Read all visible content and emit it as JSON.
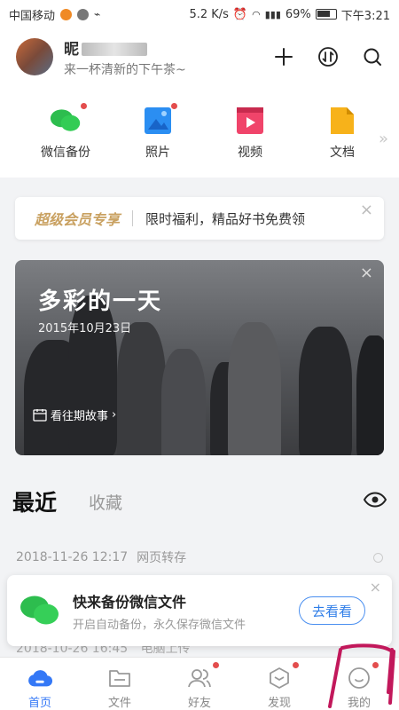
{
  "status_bar": {
    "carrier": "中国移动",
    "speed": "5.2 K/s",
    "battery": "69%",
    "time": "下午3:21"
  },
  "header": {
    "username_visible": "昵",
    "tagline": "来一杯清新的下午茶~",
    "icons": [
      "add-icon",
      "transfer-icon",
      "search-icon"
    ]
  },
  "quick_access": [
    {
      "label": "微信备份",
      "icon": "wechat-icon",
      "badge": true
    },
    {
      "label": "照片",
      "icon": "photo-icon",
      "badge": true
    },
    {
      "label": "视频",
      "icon": "video-icon",
      "badge": false
    },
    {
      "label": "文档",
      "icon": "document-icon",
      "badge": false
    }
  ],
  "vip_banner": {
    "title": "超级会员专享",
    "text": "限时福利，精品好书免费领"
  },
  "memory_card": {
    "title": "多彩的一天",
    "date": "2015年10月23日",
    "link": "看往期故事"
  },
  "tabs": {
    "active": "最近",
    "other": "收藏"
  },
  "recent": [
    {
      "date": "2018-11-26 12:17",
      "source": "网页转存"
    },
    {
      "date": "2018-10-26 16:45",
      "source": "电脑上传"
    }
  ],
  "backup_prompt": {
    "title": "快来备份微信文件",
    "subtitle": "开启自动备份，永久保存微信文件",
    "button": "去看看"
  },
  "bottom_nav": [
    {
      "label": "首页",
      "icon": "cloud-home-icon",
      "active": true,
      "badge": false
    },
    {
      "label": "文件",
      "icon": "folder-icon",
      "active": false,
      "badge": false
    },
    {
      "label": "好友",
      "icon": "friends-icon",
      "active": false,
      "badge": true
    },
    {
      "label": "发现",
      "icon": "discover-icon",
      "active": false,
      "badge": true
    },
    {
      "label": "我的",
      "icon": "profile-icon",
      "active": false,
      "badge": true
    }
  ],
  "colors": {
    "accent": "#3478f6",
    "badge": "#e34d4d",
    "vip_gold": "#c9a161",
    "wechat_green": "#2dbd4e",
    "annotation": "#c2185b"
  }
}
